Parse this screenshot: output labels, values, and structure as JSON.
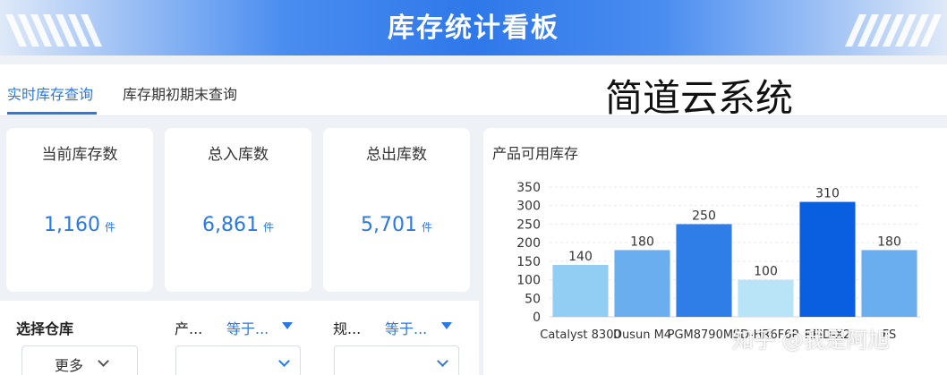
{
  "banner": {
    "title": "库存统计看板"
  },
  "tabs": [
    {
      "label": "实时库存查询",
      "active": true
    },
    {
      "label": "库存期初期末查询",
      "active": false
    }
  ],
  "watermark_title": "简道云系统",
  "kpis": [
    {
      "label": "当前库存数",
      "value": "1,160",
      "unit": "件"
    },
    {
      "label": "总入库数",
      "value": "6,861",
      "unit": "件"
    },
    {
      "label": "总出库数",
      "value": "5,701",
      "unit": "件"
    }
  ],
  "filters": {
    "warehouse_label": "选择仓库",
    "more_label": "更多",
    "product_label": "产...",
    "product_op": "等于...",
    "spec_label": "规...",
    "spec_op": "等于..."
  },
  "chart_panel": {
    "title": "产品可用库存"
  },
  "chart_data": {
    "type": "bar",
    "title": "产品可用库存",
    "categories": [
      "Catalyst 8300",
      "Dusun M4",
      "PGM8790M5",
      "SD-HR6F6P",
      "RFID-X2",
      "FS"
    ],
    "values": [
      140,
      180,
      250,
      100,
      310,
      180
    ],
    "colors": [
      "#92cdf3",
      "#6aaeef",
      "#2f7de6",
      "#b9e4f7",
      "#0a5ee0",
      "#6aaeef"
    ],
    "ylim": [
      0,
      350
    ],
    "yticks": [
      0,
      50,
      100,
      150,
      200,
      250,
      300,
      350
    ],
    "grid": true,
    "data_labels": true
  },
  "overlay_watermark": "知乎 @我是阿旭",
  "colors": {
    "accent": "#2a78e4",
    "banner": "#2f78ea"
  }
}
